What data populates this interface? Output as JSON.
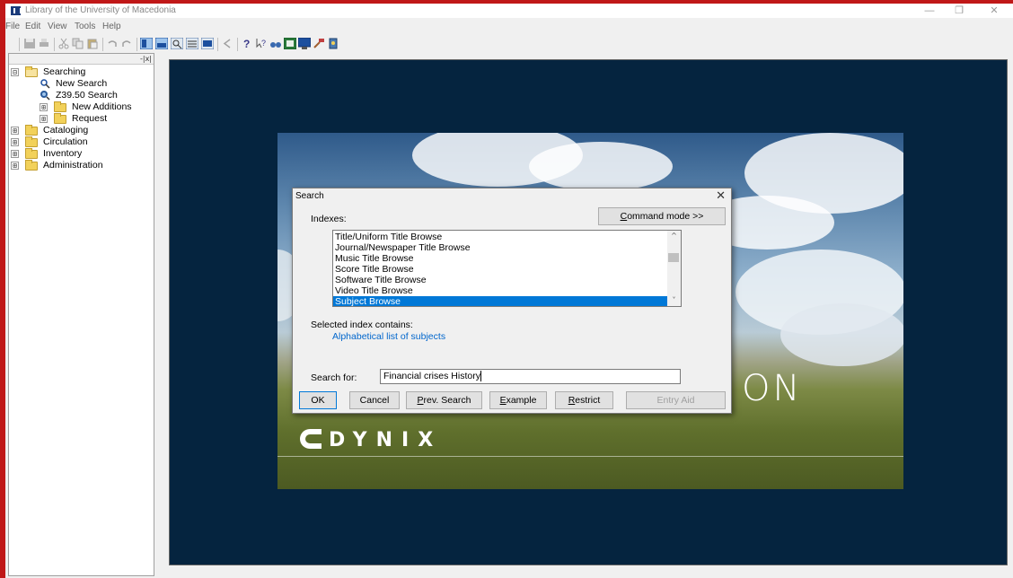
{
  "window": {
    "title": "Library of the University of Macedonia",
    "controls": [
      "—",
      "❐",
      "✕"
    ]
  },
  "menu": [
    "File",
    "Edit",
    "View",
    "Tools",
    "Help"
  ],
  "tree": {
    "items": [
      {
        "label": "Searching",
        "expander": "⊟"
      },
      {
        "label": "New Search"
      },
      {
        "label": "Z39.50 Search"
      },
      {
        "label": "New Additions",
        "expander": "⊞"
      },
      {
        "label": "Request",
        "expander": "⊞"
      },
      {
        "label": "Cataloging",
        "expander": "⊞"
      },
      {
        "label": "Circulation",
        "expander": "⊞"
      },
      {
        "label": "Inventory",
        "expander": "⊞"
      },
      {
        "label": "Administration",
        "expander": "⊞"
      }
    ],
    "close_glyph": "-|x|"
  },
  "splash": {
    "partial_word": "ON",
    "logo": "DYNIX"
  },
  "dialog": {
    "title": "Search",
    "close": "✕",
    "indexes_label": "Indexes:",
    "command_mode": {
      "u": "C",
      "rest": "ommand mode >>"
    },
    "indexes": [
      "Title/Uniform Title Browse",
      "Journal/Newspaper Title Browse",
      "Music Title Browse",
      "Score Title Browse",
      "Software Title Browse",
      "Video Title Browse",
      "Subject Browse"
    ],
    "selected_index": 6,
    "scroll_up": "^",
    "scroll_down": "˅",
    "selected_contains_label": "Selected index contains:",
    "selected_contains_value": "Alphabetical list of subjects",
    "search_for_label": "Search for:",
    "search_value": "Financial crises History",
    "buttons": {
      "ok": "OK",
      "cancel": "Cancel",
      "prev_search": {
        "u": "P",
        "rest": "rev. Search"
      },
      "example": {
        "u": "E",
        "rest": "xample"
      },
      "restrict": {
        "u": "R",
        "rest": "estrict"
      },
      "entry_aid": "Entry Aid"
    }
  },
  "colors": {
    "workspace_bg": "#05243f",
    "selection": "#0078d7",
    "link": "#0066cc",
    "outer_frame": "#c01818"
  }
}
